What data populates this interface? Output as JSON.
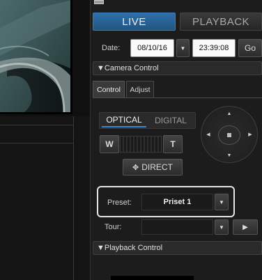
{
  "tabs": {
    "live": "LIVE",
    "playback": "PLAYBACK"
  },
  "date_row": {
    "label": "Date:",
    "date": "08/10/16",
    "time": "23:39:08",
    "go": "Go"
  },
  "camera_control": {
    "header": "▼Camera Control",
    "subtabs": [
      "Control",
      "Adjust"
    ],
    "zoom_modes": [
      "OPTICAL",
      "DIGITAL"
    ],
    "zoom_wide": "W",
    "zoom_tele": "T",
    "direct_label": "DIRECT",
    "preset_label": "Preset:",
    "preset_value": "Priset 1",
    "tour_label": "Tour:",
    "tour_value": ""
  },
  "playback_control": {
    "header": "▼Playback Control"
  },
  "colors": {
    "live_tab": "#2f6fa8",
    "panel": "#1c1c1c",
    "highlight_border": "#e6e6e6"
  }
}
